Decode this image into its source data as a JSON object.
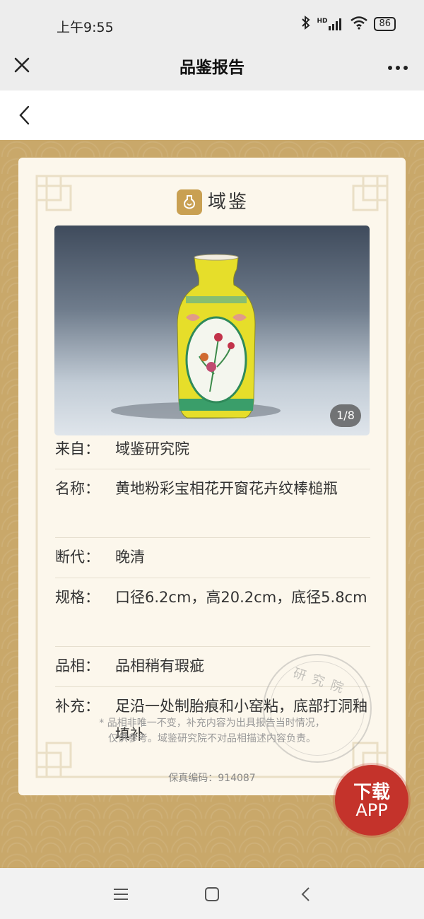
{
  "status_bar": {
    "time": "上午9:55",
    "network": "HD",
    "battery": "86"
  },
  "title_bar": {
    "title": "品鉴报告"
  },
  "logo": {
    "name": "域鉴"
  },
  "photo": {
    "counter": "1/8"
  },
  "info": [
    {
      "label": "来自：",
      "value": "域鉴研究院"
    },
    {
      "label": "名称：",
      "value": "黄地粉彩宝相花开窗花卉纹棒槌瓶"
    },
    {
      "label": "断代：",
      "value": "晚清"
    },
    {
      "label": "规格：",
      "value": "口径6.2cm，高20.2cm，底径5.8cm"
    },
    {
      "label": "品相：",
      "value": "品相稍有瑕疵"
    },
    {
      "label": "补充：",
      "value": "足沿一处制胎痕和小窑粘，底部打洞釉填补"
    }
  ],
  "note": {
    "line1": "* 品相非唯一不变，补充内容为出具报告当时情况，",
    "line2": "仅供参考。域鉴研究院不对品相描述内容负责。"
  },
  "verify_code": "保真编码：914087",
  "seal_text": "研 究 院",
  "download": {
    "line1": "下载",
    "line2": "APP"
  },
  "colors": {
    "gold_background": "#c9a86a",
    "card_background": "#fcf7ec",
    "download_red": "#c4332b"
  }
}
